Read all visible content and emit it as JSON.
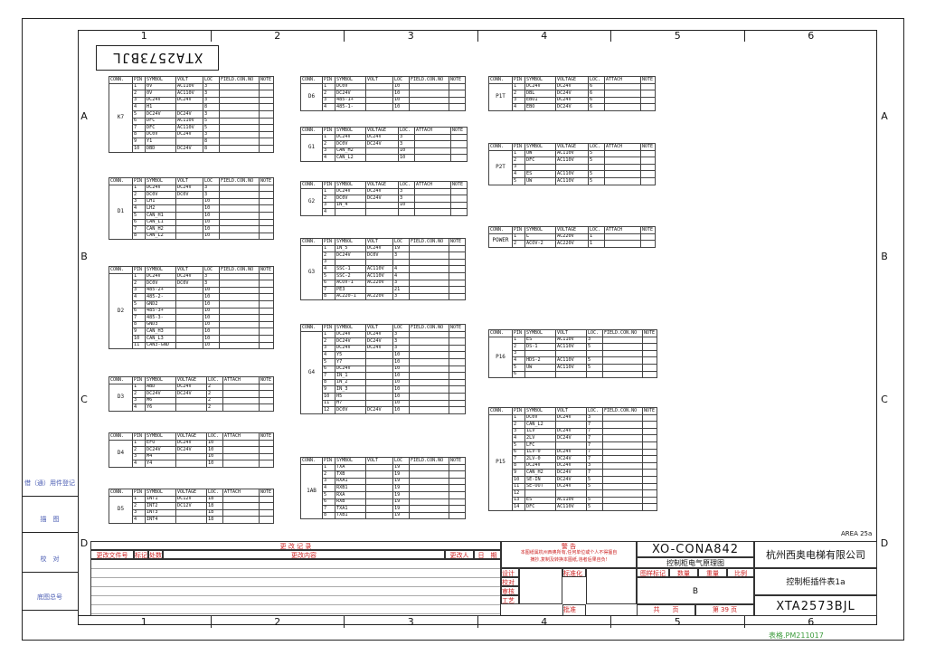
{
  "zones_top": [
    "1",
    "2",
    "3",
    "4",
    "5",
    "6"
  ],
  "zones_bottom": [
    "1",
    "2",
    "3",
    "4",
    "5",
    "6"
  ],
  "rows": [
    "A",
    "B",
    "C",
    "D"
  ],
  "drawing_no_mirrored": "XTA2573BJL",
  "side_labels": [
    "借（通）用件登记",
    "描　图",
    "校　对",
    "底图总号"
  ],
  "area_note": "AREA 25a",
  "tables": [
    {
      "conn": "K7",
      "hdr": [
        "CONN.",
        "PIN",
        "SYMBOL",
        "VOLT",
        "LOC",
        "FIELD.CON.NO",
        "NOTE"
      ],
      "rows": [
        [
          "1",
          "0V",
          "AC110V",
          "3"
        ],
        [
          "2",
          "0V",
          "AC110V",
          "3"
        ],
        [
          "3",
          "DC24V",
          "DC24V",
          "3"
        ],
        [
          "4",
          "H1",
          "",
          "8"
        ],
        [
          "5",
          "DC24V",
          "DC24V",
          "3"
        ],
        [
          "6",
          "DFC",
          "AC110V",
          "5"
        ],
        [
          "7",
          "DFC",
          "AC110V",
          "5"
        ],
        [
          "8",
          "DC0V",
          "DC24V",
          "3"
        ],
        [
          "9",
          "Y1",
          "",
          "8"
        ],
        [
          "10",
          "DBD",
          "DC24V",
          "8"
        ]
      ]
    },
    {
      "conn": "D1",
      "hdr": [
        "CONN.",
        "PIN",
        "SYMBOL",
        "VOLT",
        "LOC",
        "FIELD.CON.NO",
        "NOTE"
      ],
      "rows": [
        [
          "1",
          "DC24V",
          "DC24V",
          "3"
        ],
        [
          "2",
          "DC0V",
          "DC0V",
          "3"
        ],
        [
          "3",
          "LH1",
          "",
          "10"
        ],
        [
          "4",
          "LH2",
          "",
          "10"
        ],
        [
          "5",
          "CAN_H1",
          "",
          "10"
        ],
        [
          "6",
          "CAN_L1",
          "",
          "10"
        ],
        [
          "7",
          "CAN_H2",
          "",
          "10"
        ],
        [
          "8",
          "CAN_L2",
          "",
          "10"
        ]
      ]
    },
    {
      "conn": "D2",
      "hdr": [
        "CONN.",
        "PIN",
        "SYMBOL",
        "VOLT",
        "LOC",
        "FIELD.CON.NO",
        "NOTE"
      ],
      "rows": [
        [
          "1",
          "DC24V",
          "DC24V",
          "3"
        ],
        [
          "2",
          "DC0V",
          "DC0V",
          "3"
        ],
        [
          "3",
          "485-2+",
          "",
          "10"
        ],
        [
          "4",
          "485-2-",
          "",
          "10"
        ],
        [
          "5",
          "GND2",
          "",
          "10"
        ],
        [
          "6",
          "485-3+",
          "",
          "10"
        ],
        [
          "7",
          "485-3-",
          "",
          "10"
        ],
        [
          "8",
          "GND3",
          "",
          "10"
        ],
        [
          "9",
          "CAN_H3",
          "",
          "10"
        ],
        [
          "10",
          "CAN_L3",
          "",
          "10"
        ],
        [
          "11",
          "CAN3-GND",
          "",
          "10"
        ]
      ]
    },
    {
      "conn": "D3",
      "hdr": [
        "CONN.",
        "PIN",
        "SYMBOL",
        "VOLTAGE",
        "LOC.",
        "ATTACH",
        "NOTE"
      ],
      "rows": [
        [
          "1",
          "ABD",
          "DC24V",
          "2"
        ],
        [
          "2",
          "DC24V",
          "DC24V",
          "2"
        ],
        [
          "3",
          "M6",
          "",
          "2"
        ],
        [
          "4",
          "Y6",
          "",
          "2"
        ]
      ]
    },
    {
      "conn": "D4",
      "hdr": [
        "CONN.",
        "PIN",
        "SYMBOL",
        "VOLTAGE",
        "LOC.",
        "ATTACH",
        "NOTE"
      ],
      "rows": [
        [
          "1",
          "EFO",
          "DC24V",
          "10"
        ],
        [
          "2",
          "DC24V",
          "DC24V",
          "10"
        ],
        [
          "3",
          "M4",
          "",
          "10"
        ],
        [
          "4",
          "Y4",
          "",
          "10"
        ]
      ]
    },
    {
      "conn": "D5",
      "hdr": [
        "CONN.",
        "PIN",
        "SYMBOL",
        "VOLTAGE",
        "LOC.",
        "ATTACH",
        "NOTE"
      ],
      "rows": [
        [
          "1",
          "INT1",
          "DC12V",
          "18"
        ],
        [
          "2",
          "INT2",
          "DC12V",
          "18"
        ],
        [
          "3",
          "INT3",
          "",
          "18"
        ],
        [
          "4",
          "INT4",
          "",
          "18"
        ]
      ]
    },
    {
      "conn": "D6",
      "hdr": [
        "CONN.",
        "PIN",
        "SYMBOL",
        "VOLT",
        "LOC",
        "FIELD.CON.NO",
        "NOTE"
      ],
      "rows": [
        [
          "1",
          "DC0V",
          "",
          "10"
        ],
        [
          "2",
          "DC24V",
          "",
          "10"
        ],
        [
          "3",
          "485-1+",
          "",
          "10"
        ],
        [
          "4",
          "485-1-",
          "",
          "10"
        ]
      ]
    },
    {
      "conn": "G1",
      "hdr": [
        "CONN.",
        "PIN",
        "SYMBOL",
        "VOLTAGE",
        "LOC.",
        "ATTACH",
        "NOTE"
      ],
      "rows": [
        [
          "1",
          "DC24V",
          "DC24V",
          "3"
        ],
        [
          "2",
          "DC0V",
          "DC24V",
          "3"
        ],
        [
          "3",
          "CAN_H2",
          "",
          "10"
        ],
        [
          "4",
          "CAN_L2",
          "",
          "10"
        ]
      ]
    },
    {
      "conn": "G2",
      "hdr": [
        "CONN.",
        "PIN",
        "SYMBOL",
        "VOLTAGE",
        "LOC.",
        "ATTACH",
        "NOTE"
      ],
      "rows": [
        [
          "1",
          "DC24V",
          "DC24V",
          "3"
        ],
        [
          "2",
          "DC0V",
          "DC24V",
          "3"
        ],
        [
          "3",
          "IN_4",
          "",
          "10"
        ],
        [
          "4",
          "",
          "",
          ""
        ]
      ]
    },
    {
      "conn": "G3",
      "hdr": [
        "CONN.",
        "PIN",
        "SYMBOL",
        "VOLT",
        "LOC",
        "FIELD.CON.NO",
        "NOTE"
      ],
      "rows": [
        [
          "1",
          "IN_5",
          "DC24V",
          "19"
        ],
        [
          "2",
          "DC24V",
          "DC0V",
          "3"
        ],
        [
          "3",
          "",
          "",
          ""
        ],
        [
          "4",
          "SSC-1",
          "AC110V",
          "4"
        ],
        [
          "5",
          "SSC-2",
          "AC110V",
          "4"
        ],
        [
          "6",
          "ACOV-1",
          "AC220V",
          "3"
        ],
        [
          "7",
          "PE3",
          "",
          "21"
        ],
        [
          "8",
          "AC220-1",
          "AC220V",
          "3"
        ]
      ]
    },
    {
      "conn": "G4",
      "hdr": [
        "CONN.",
        "PIN",
        "SYMBOL",
        "VOLT",
        "LOC",
        "FIELD.CON.NO",
        "NOTE"
      ],
      "rows": [
        [
          "1",
          "DC24V",
          "DC24V",
          "3"
        ],
        [
          "2",
          "DC24V",
          "DC24V",
          "3"
        ],
        [
          "3",
          "DC24V",
          "DC24V",
          "3"
        ],
        [
          "4",
          "Y5",
          "",
          "10"
        ],
        [
          "5",
          "Y7",
          "",
          "10"
        ],
        [
          "6",
          "DC24V",
          "",
          "10"
        ],
        [
          "7",
          "IN_1",
          "",
          "10"
        ],
        [
          "8",
          "IN_2",
          "",
          "10"
        ],
        [
          "9",
          "IN_3",
          "",
          "10"
        ],
        [
          "10",
          "H5",
          "",
          "10"
        ],
        [
          "11",
          "H7",
          "",
          "10"
        ],
        [
          "12",
          "DC0V",
          "DC24V",
          "10"
        ]
      ]
    },
    {
      "conn": "1AB",
      "hdr": [
        "CONN.",
        "PIN",
        "SYMBOL",
        "VOLT",
        "LOC",
        "FIELD.CON.NO",
        "NOTE"
      ],
      "rows": [
        [
          "1",
          "TXA",
          "",
          "19"
        ],
        [
          "2",
          "TXB",
          "",
          "19"
        ],
        [
          "3",
          "RXA1",
          "",
          "19"
        ],
        [
          "4",
          "RXB1",
          "",
          "19"
        ],
        [
          "5",
          "RXA",
          "",
          "19"
        ],
        [
          "6",
          "RXB",
          "",
          "19"
        ],
        [
          "7",
          "TXA1",
          "",
          "19"
        ],
        [
          "8",
          "TXB1",
          "",
          "19"
        ]
      ]
    },
    {
      "conn": "P1T",
      "hdr": [
        "CONN.",
        "PIN",
        "SYMBOL",
        "VOLTAGE",
        "LOC.",
        "ATTACH",
        "NOTE"
      ],
      "rows": [
        [
          "1",
          "DC24V",
          "DC24V",
          "6"
        ],
        [
          "2",
          "DBL",
          "DC24V",
          "6"
        ],
        [
          "3",
          "EBO1",
          "DC24V",
          "6"
        ],
        [
          "4",
          "EBO",
          "DC24V",
          "6"
        ]
      ]
    },
    {
      "conn": "P2T",
      "hdr": [
        "CONN.",
        "PIN",
        "SYMBOL",
        "VOLTAGE",
        "LOC.",
        "ATTACH",
        "NOTE"
      ],
      "rows": [
        [
          "1",
          "UW",
          "AC110V",
          "5"
        ],
        [
          "2",
          "DFC",
          "AC110V",
          "5"
        ],
        [
          "3",
          "",
          "",
          ""
        ],
        [
          "4",
          "ES",
          "AC110V",
          "5"
        ],
        [
          "5",
          "UW",
          "AC110V",
          "5"
        ]
      ]
    },
    {
      "conn": "POWER",
      "hdr": [
        "CONN.",
        "PIN",
        "SYMBOL",
        "VOLTAGE",
        "LOC.",
        "ATTACH",
        "NOTE"
      ],
      "rows": [
        [
          "1",
          "L",
          "AC220V",
          "1"
        ],
        [
          "2",
          "ACOV-2",
          "AC220V",
          "1"
        ]
      ]
    },
    {
      "conn": "P16",
      "hdr": [
        "CONN.",
        "PIN",
        "SYMBOL",
        "VOLT",
        "LOC.",
        "FIELD.CON.NO",
        "NOTE"
      ],
      "rows": [
        [
          "1",
          "ES",
          "AC110V",
          "3"
        ],
        [
          "2",
          "DS-1",
          "AC110V",
          "5"
        ],
        [
          "3",
          "",
          "",
          ""
        ],
        [
          "4",
          "HDS-2",
          "AC110V",
          "5"
        ],
        [
          "5",
          "UW",
          "AC110V",
          "5"
        ],
        [
          "6",
          "",
          "",
          ""
        ]
      ]
    },
    {
      "conn": "P15",
      "hdr": [
        "CONN.",
        "PIN",
        "SYMBOL",
        "VOLT",
        "LOC.",
        "FIELD.CON.NO",
        "NOTE"
      ],
      "rows": [
        [
          "1",
          "DC0V",
          "DC24V",
          "3"
        ],
        [
          "2",
          "CAN_L2",
          "",
          "7"
        ],
        [
          "3",
          "1LV",
          "DC24V",
          "7"
        ],
        [
          "4",
          "2LV",
          "DC24V",
          "7"
        ],
        [
          "5",
          "LFC",
          "",
          "7"
        ],
        [
          "6",
          "1LV-0",
          "DC24V",
          "7"
        ],
        [
          "7",
          "2LV-0",
          "DC24V",
          "7"
        ],
        [
          "8",
          "DC24V",
          "DC24V",
          "3"
        ],
        [
          "9",
          "CAN_H2",
          "DC24V",
          "7"
        ],
        [
          "10",
          "SE-IN",
          "DC24V",
          "5"
        ],
        [
          "11",
          "SE-OUT",
          "DC24V",
          "5"
        ],
        [
          "12",
          "",
          "",
          ""
        ],
        [
          "13",
          "ES",
          "AC110V",
          "5"
        ],
        [
          "14",
          "DFC",
          "AC110V",
          "5"
        ]
      ]
    }
  ],
  "title_block": {
    "rev_title": "更 改 记 录",
    "col_doc": "更改文件号",
    "col_mark": "标记",
    "col_count": "处数",
    "col_content": "更改内容",
    "col_person": "更改人",
    "col_date": "日　期",
    "warn_title": "警 告",
    "warn_line1": "本图纸属杭州西奥所有,任何单位或个人不得擅自",
    "warn_line2": "摘抄,复制及转换本图纸,违者后果自负!",
    "roles": [
      "设计",
      "校对",
      "审核",
      "工艺"
    ],
    "std": "标准化",
    "approve": "批准",
    "drawing_code": "XO-CONA842",
    "drawing_name": "控制柜电气原理图",
    "company": "杭州西奥电梯有限公司",
    "sheet_label": "图样标记",
    "qty_label": "数量",
    "weight_label": "重量",
    "scale_label": "比例",
    "sheet_mark": "B",
    "total_label": "共　　页",
    "page_label": "第 39 页",
    "subject": "控制柜插件表1a",
    "drawing_no": "XTA2573BJL"
  },
  "form_code": "表格.PM211017"
}
